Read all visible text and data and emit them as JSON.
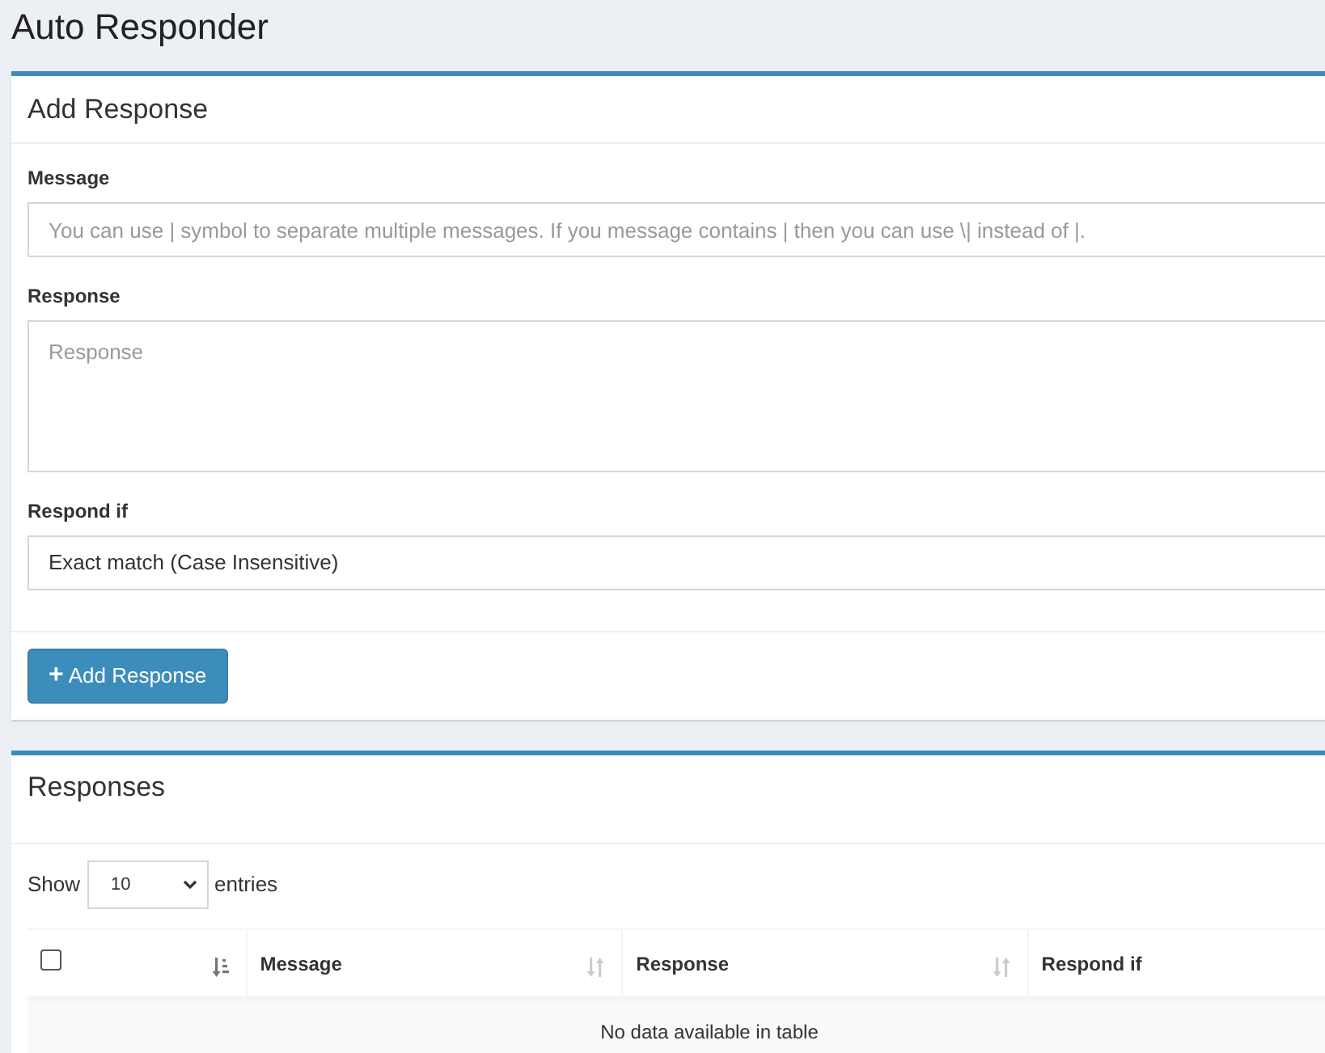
{
  "page_title": "Auto Responder",
  "add_card": {
    "title": "Add Response",
    "fields": [
      {
        "kind": "input",
        "label": "Message",
        "placeholder": "You can use | symbol to separate multiple messages. If you message contains | then you can use \\| instead of |."
      },
      {
        "kind": "textarea",
        "label": "Response",
        "placeholder": "Response"
      },
      {
        "kind": "select",
        "label": "Respond if",
        "value": "Exact match (Case Insensitive)"
      }
    ],
    "button": {
      "icon": "+",
      "label": "Add Response"
    }
  },
  "responses_card": {
    "title": "Responses",
    "length": {
      "before": "Show",
      "value": "10",
      "after": "entries"
    },
    "table": {
      "columns": [
        {
          "kind": "checkbox",
          "checked": false,
          "sorted": true
        },
        {
          "kind": "text",
          "label": "Message",
          "sorted": false
        },
        {
          "kind": "text",
          "label": "Response",
          "sorted": false
        },
        {
          "kind": "text",
          "label": "Respond if"
        }
      ],
      "empty_message": "No data available in table"
    }
  }
}
